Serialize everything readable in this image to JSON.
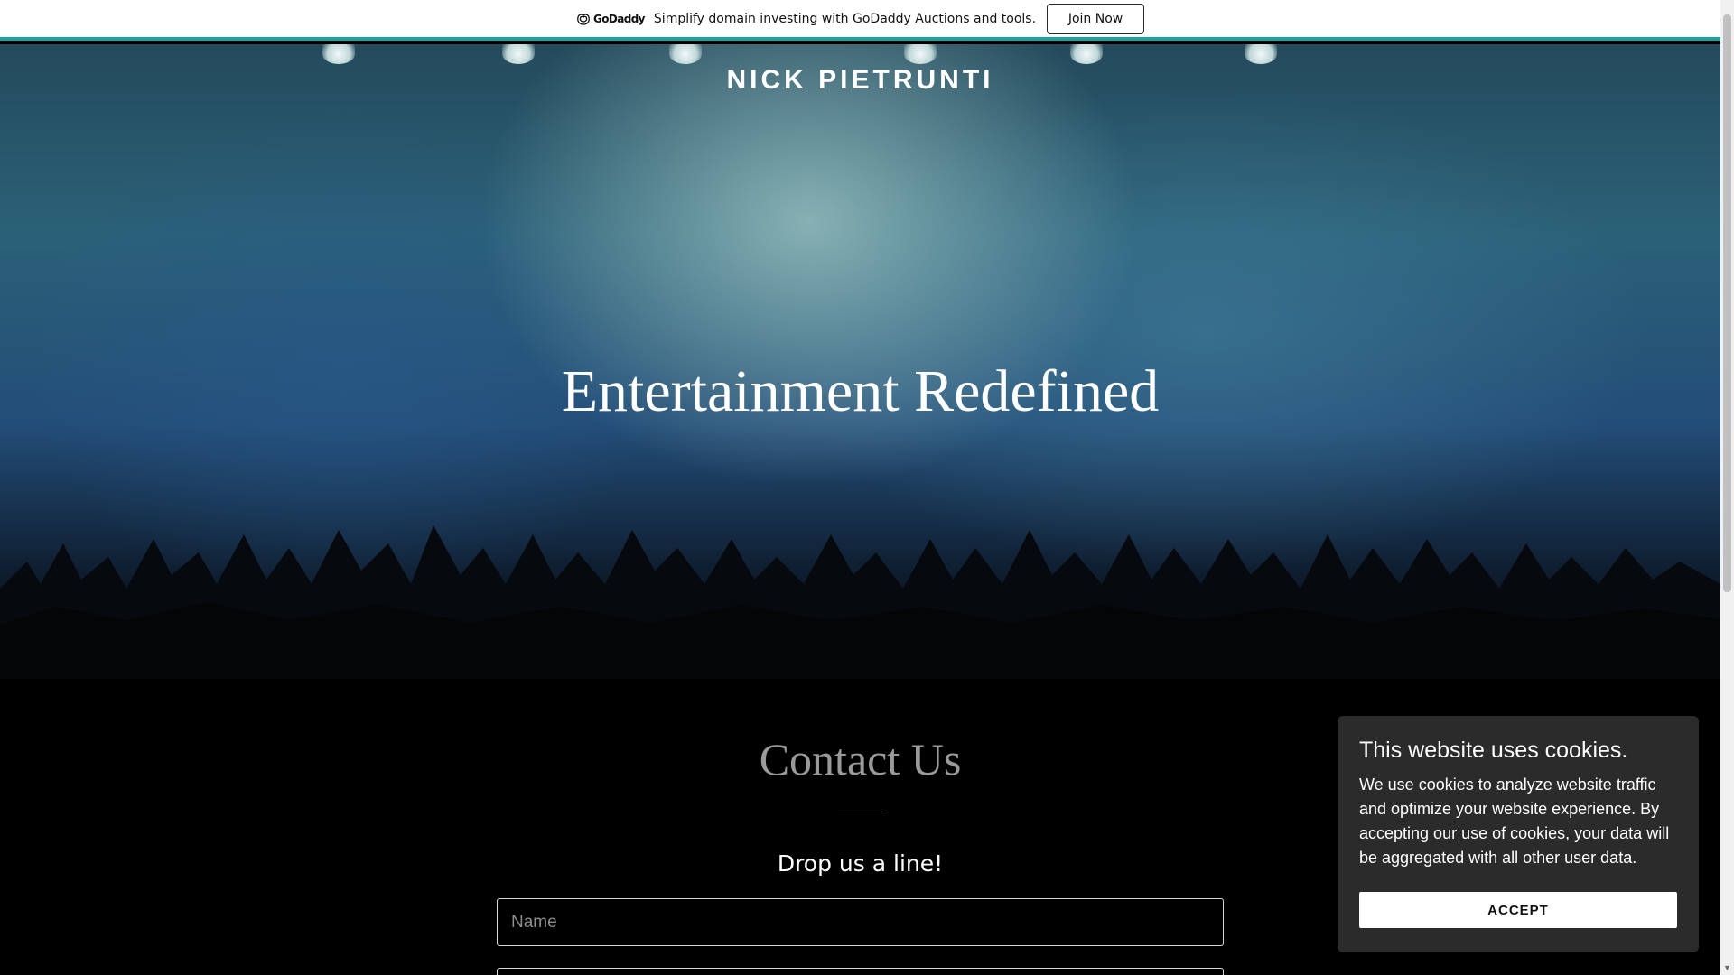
{
  "banner": {
    "logo_text": "GoDaddy",
    "message": "Simplify domain investing with GoDaddy Auctions and tools.",
    "join_label": "Join Now",
    "accent_color": "#1aa3a3"
  },
  "hero": {
    "site_name": "NICK PIETRUNTI",
    "headline": "Entertainment Redefined"
  },
  "contact": {
    "title": "Contact Us",
    "subtitle": "Drop us a line!",
    "name_placeholder": "Name"
  },
  "cookie_notice": {
    "title": "This website uses cookies.",
    "text": "We use cookies to analyze website traffic and optimize your website experience. By accepting our use of cookies, your data will be aggregated with all other user data.",
    "accept_label": "ACCEPT"
  },
  "scrollbar": {
    "down_arrow": "▼"
  }
}
